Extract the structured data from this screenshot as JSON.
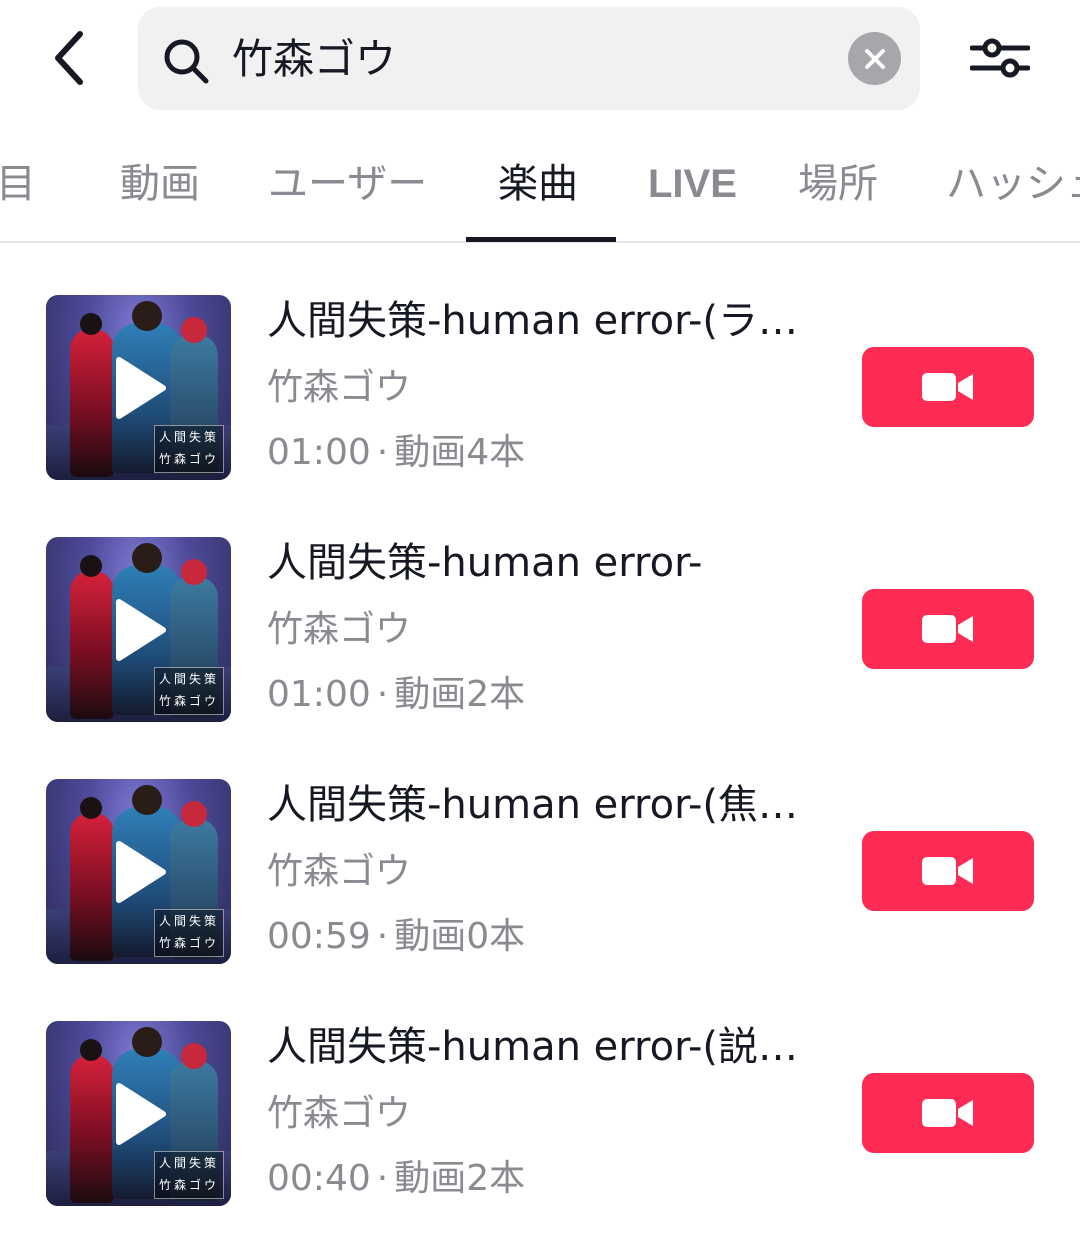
{
  "search": {
    "query": "竹森ゴウ",
    "back_icon": "chevron-left-icon",
    "search_icon": "search-icon",
    "clear_icon": "close-icon",
    "filter_icon": "sliders-icon"
  },
  "tabs": [
    {
      "label": "注目",
      "active": false
    },
    {
      "label": "動画",
      "active": false
    },
    {
      "label": "ユーザー",
      "active": false
    },
    {
      "label": "楽曲",
      "active": true
    },
    {
      "label": "LIVE",
      "active": false
    },
    {
      "label": "場所",
      "active": false
    },
    {
      "label": "ハッシュ",
      "active": false
    }
  ],
  "songs": [
    {
      "title": "人間失策-human error-(ラ…",
      "artist": "竹森ゴウ",
      "duration": "01:00",
      "video_count": "動画4本"
    },
    {
      "title": "人間失策-human error-",
      "artist": "竹森ゴウ",
      "duration": "01:00",
      "video_count": "動画2本"
    },
    {
      "title": "人間失策-human error-(焦…",
      "artist": "竹森ゴウ",
      "duration": "00:59",
      "video_count": "動画0本"
    },
    {
      "title": "人間失策-human error-(説…",
      "artist": "竹森ゴウ",
      "duration": "00:40",
      "video_count": "動画2本"
    }
  ],
  "thumbnail_text": "人間失策 竹森ゴウ",
  "colors": {
    "accent": "#fe2c55",
    "primary_text": "#161823",
    "secondary_text": "#8a8b91",
    "search_bg": "#f1f1f2"
  },
  "icons": {
    "play": "play-icon",
    "use_sound": "video-camera-icon"
  }
}
